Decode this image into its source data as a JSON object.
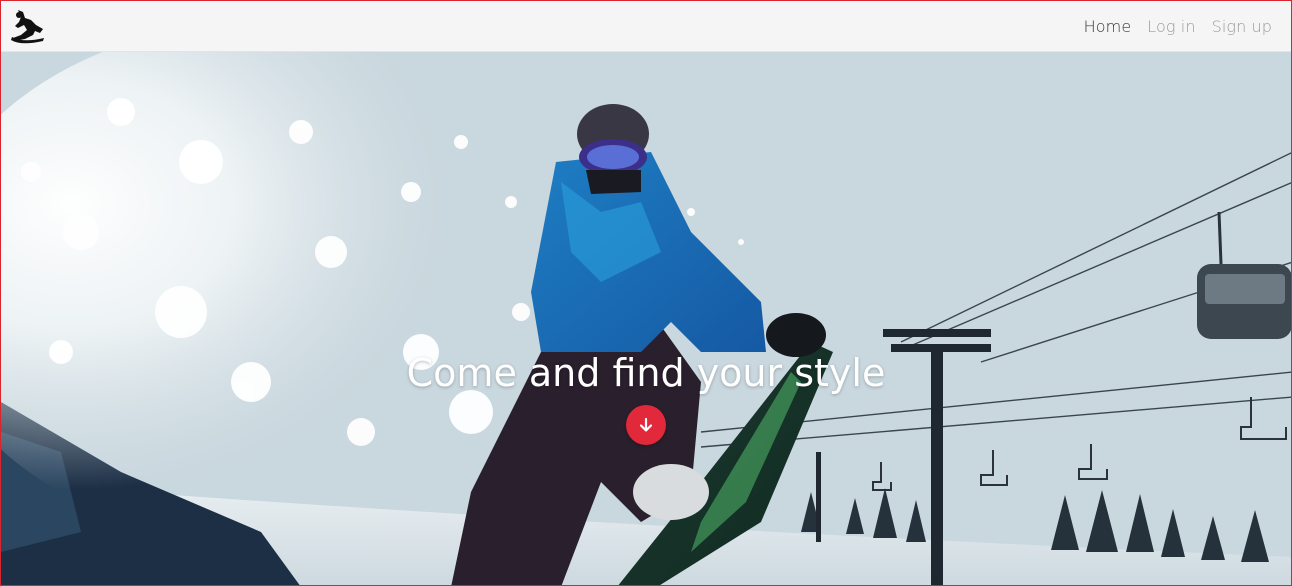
{
  "nav": {
    "logo_icon": "snowboarder-logo-icon",
    "links": [
      {
        "label": "Home",
        "active": true
      },
      {
        "label": "Log in",
        "active": false
      },
      {
        "label": "Sign up",
        "active": false
      }
    ]
  },
  "hero": {
    "title": "Come and find your style",
    "scroll_icon": "arrow-down-icon",
    "accent_color": "#e2283b"
  }
}
